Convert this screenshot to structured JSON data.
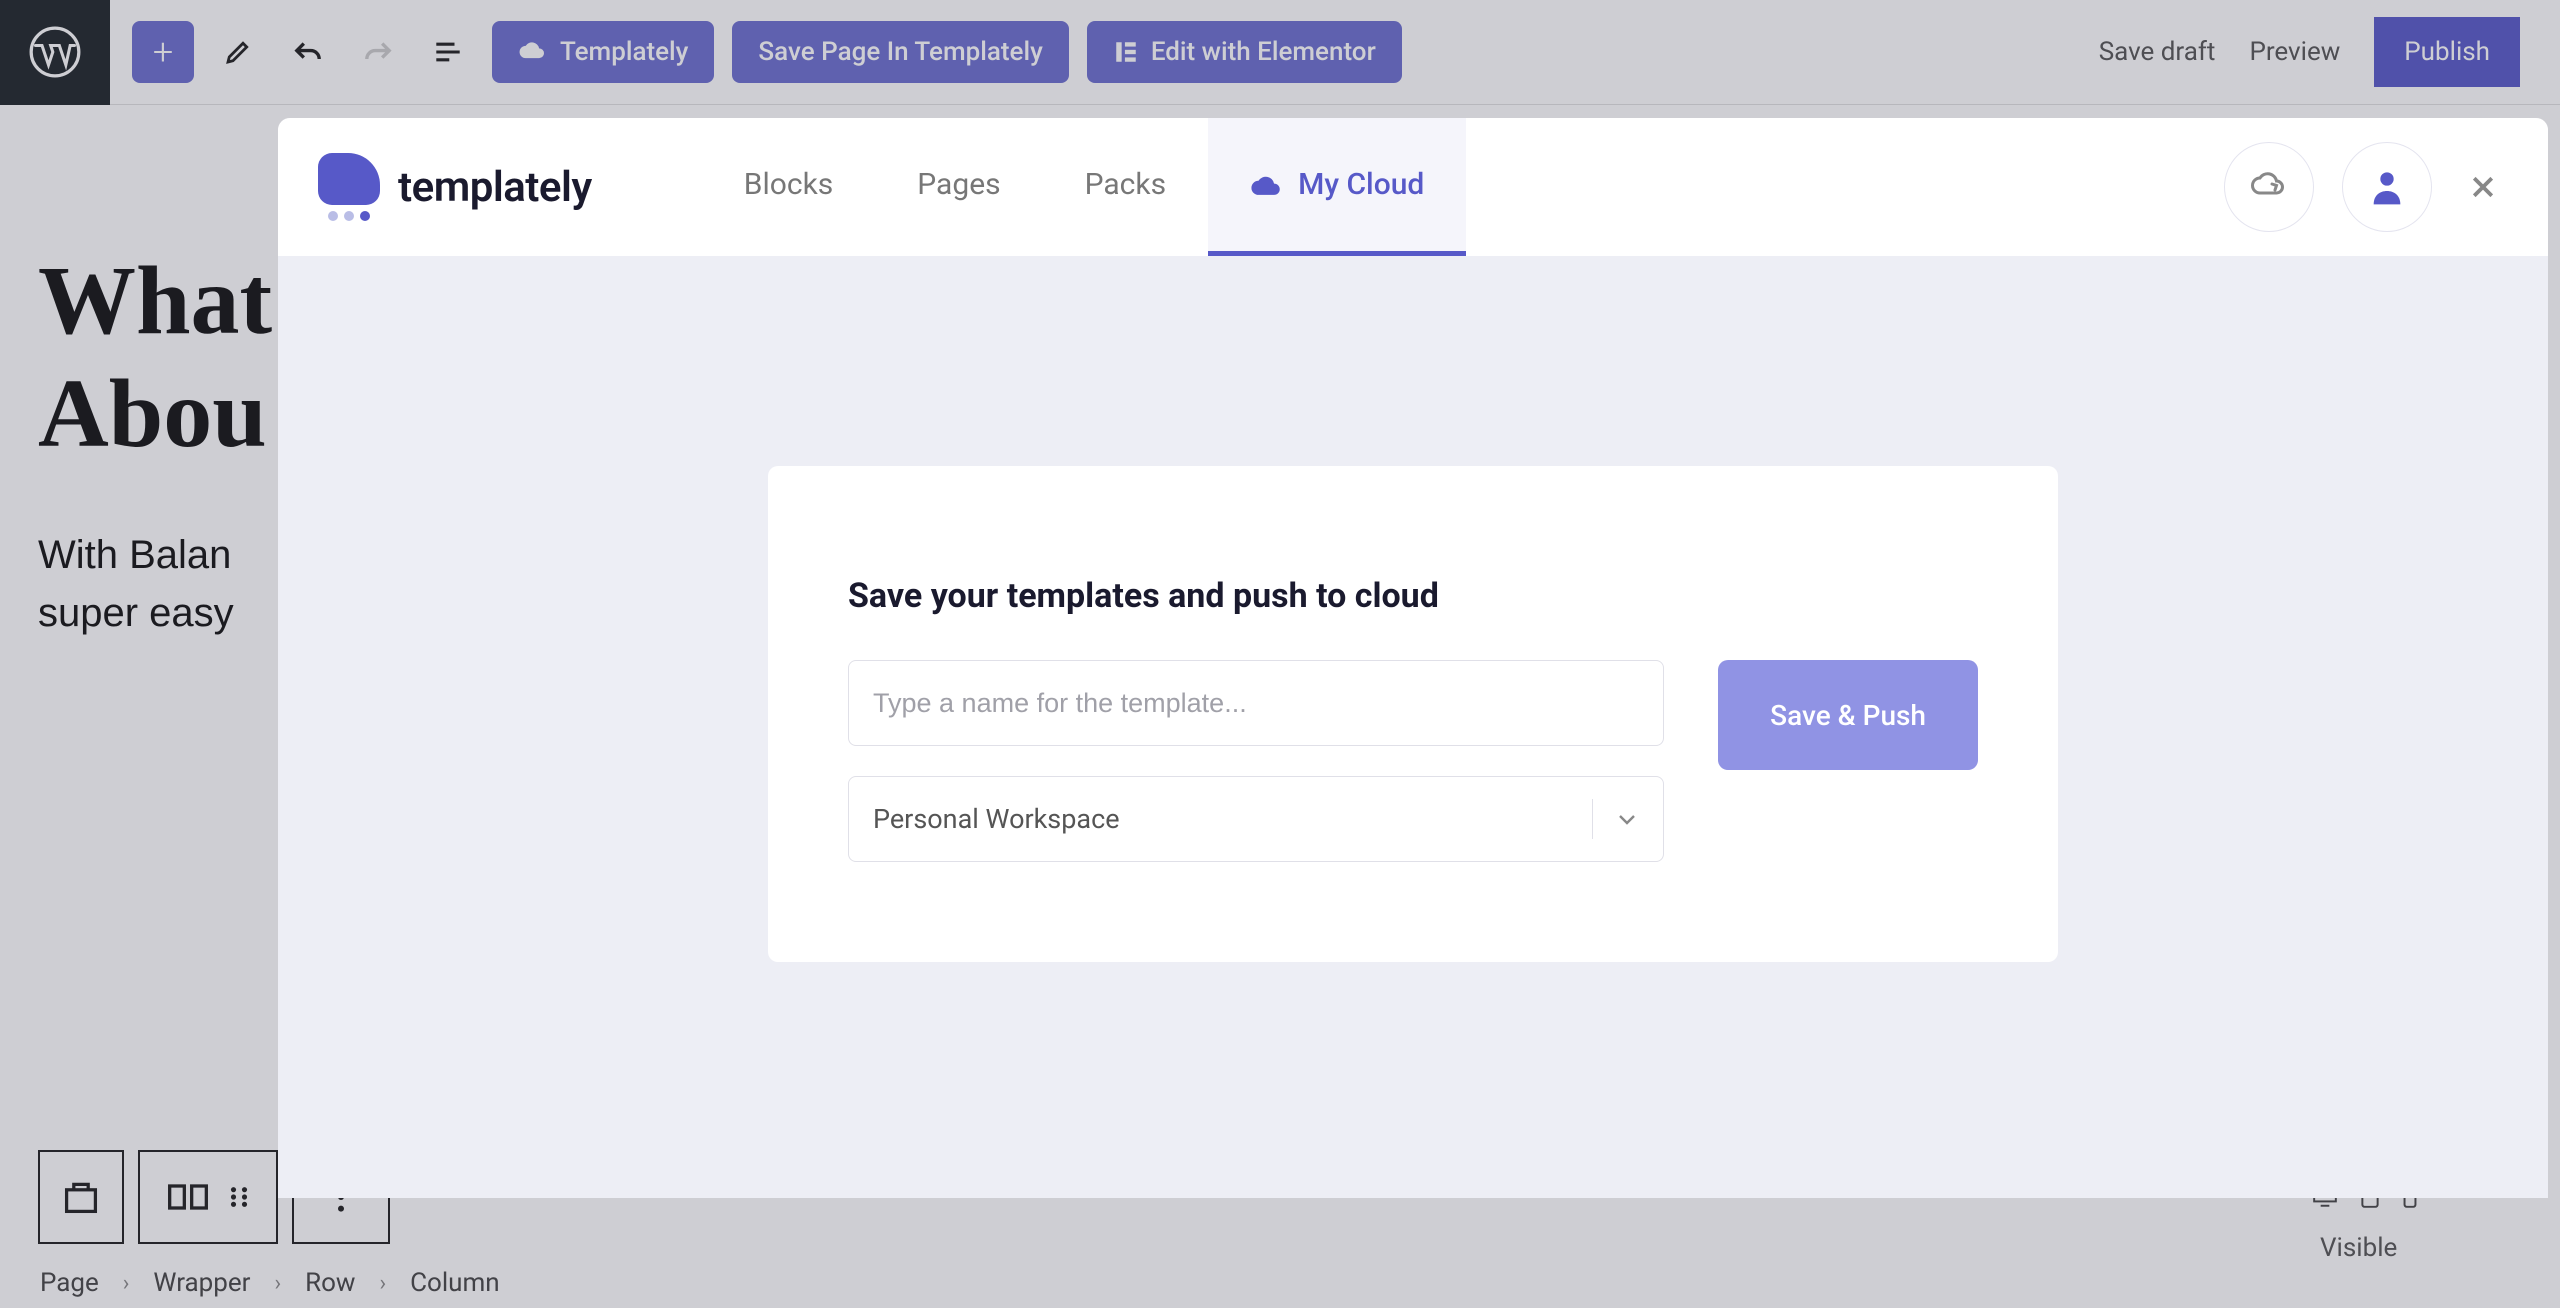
{
  "toolbar": {
    "templately_label": "Templately",
    "save_in_templately_label": "Save Page In Templately",
    "edit_elementor_label": "Edit with Elementor",
    "save_draft_label": "Save draft",
    "preview_label": "Preview",
    "publish_label": "Publish"
  },
  "editor": {
    "heading_line1": "What",
    "heading_line2": "Abou",
    "subtext_line1": "With Balan",
    "subtext_line2": "super easy"
  },
  "breadcrumb": {
    "items": [
      "Page",
      "Wrapper",
      "Row",
      "Column"
    ]
  },
  "sidebar": {
    "visibility_label": "Visible"
  },
  "modal": {
    "brand": "templately",
    "tabs": {
      "blocks": "Blocks",
      "pages": "Pages",
      "packs": "Packs",
      "mycloud": "My Cloud"
    },
    "card": {
      "title": "Save your templates and push to cloud",
      "name_placeholder": "Type a name for the template...",
      "workspace_value": "Personal Workspace",
      "button_label": "Save & Push"
    }
  }
}
